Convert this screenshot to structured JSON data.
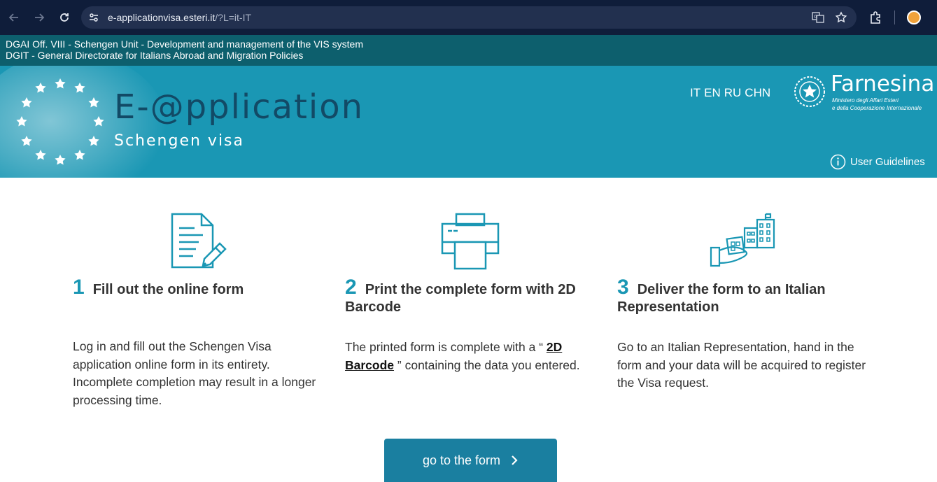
{
  "browser": {
    "url_host": "e-applicationvisa.esteri.it",
    "url_path": "/?L=it-IT"
  },
  "info_strip": {
    "line1": "DGAI Off. VIII - Schengen Unit - Development and management of the VIS system",
    "line2": "DGIT - General Directorate for Italians Abroad and Migration Policies"
  },
  "banner": {
    "title": "E-@pplication",
    "subtitle": "Schengen visa",
    "languages": [
      "IT",
      "EN",
      "RU",
      "CHN"
    ],
    "logo_name": "Farnesina",
    "logo_sub1": "Ministero degli Affari Esteri",
    "logo_sub2": "e della Cooperazione Internazionale",
    "guidelines_label": "User Guidelines"
  },
  "steps": [
    {
      "number": "1",
      "title": "Fill out the online form",
      "icon": "document-pen-icon",
      "desc": "Log in and fill out the Schengen Visa application online form in its entirety. Incomplete completion may result in a longer processing time."
    },
    {
      "number": "2",
      "title": "Print the complete form with 2D Barcode",
      "icon": "printer-icon",
      "desc_before": "The printed form is complete with a “ ",
      "desc_link": "2D Barcode",
      "desc_after": " ” containing the data you entered."
    },
    {
      "number": "3",
      "title": "Deliver the form to an Italian Representation",
      "icon": "hand-building-icon",
      "desc": "Go to an Italian Representation, hand in the form and your data will be acquired to register the Visa request."
    }
  ],
  "cta": {
    "label": "go to the form"
  },
  "colors": {
    "browser_bg": "#0f1d3a",
    "strip_bg": "#0d5f6d",
    "banner_bg": "#1a97b4",
    "title_color": "#124a66",
    "accent": "#1a97b4",
    "button_bg": "#1a7fa0"
  }
}
